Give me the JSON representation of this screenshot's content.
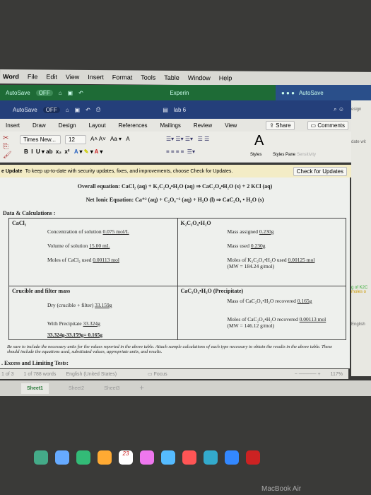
{
  "menubar": {
    "items": [
      "Word",
      "File",
      "Edit",
      "View",
      "Insert",
      "Format",
      "Tools",
      "Table",
      "Window",
      "Help"
    ]
  },
  "excel": {
    "autosave": "AutoSave",
    "toggle": "OFF",
    "doc": "Experin",
    "autosave2": "AutoSave"
  },
  "word": {
    "autosave": "AutoSave",
    "toggle": "OFF",
    "title": "lab 6"
  },
  "tabs": [
    "Insert",
    "Draw",
    "Design",
    "Layout",
    "References",
    "Mailings",
    "Review",
    "View"
  ],
  "share": "Share",
  "comments": "Comments",
  "ribbon": {
    "font": "Times New...",
    "size": "12",
    "styles": "Styles",
    "styles_pane": "Styles Pane",
    "sensitivity": "Sensitivity"
  },
  "update": {
    "label": "e Update",
    "message": "To keep up-to-date with security updates, fixes, and improvements, choose Check for Updates.",
    "button": "Check for Updates"
  },
  "doc": {
    "overall": "Overall equation: CaCl₂ (aq) + K₂C₂O₄•H₂O (aq) ⇒ CaC₂O₄•H₂O (s) + 2 KCl (aq)",
    "net": "Net Ionic Equation: Ca⁺² (aq) + C₂O₄⁻² (aq) + H₂O (l) ⇒ CaC₂O₄ • H₂O (s)",
    "section": "Data & Calculations :",
    "cacl2": {
      "head": "CaCl₂",
      "conc": "Concentration of solution",
      "conc_v": "0.075 mol/L",
      "vol": "Volume of solution",
      "vol_v": "15.00 mL",
      "moles": "Moles of CaCl₂ used",
      "moles_v": "0.00113 mol"
    },
    "k": {
      "head": "K₂C₂O₄•H₂O",
      "assigned": "Mass assigned",
      "assigned_v": "0.230g",
      "used": "Mass used",
      "used_v": "0.230g",
      "moles": "Moles of K₂C₂O₄•H₂O used",
      "moles_v": "0.00125 mol",
      "mw": "(MW = 184.24 g/mol)"
    },
    "crucible": {
      "head": "Crucible and filter mass",
      "dry": "Dry (crucible + filter)",
      "dry_v": "33.159g",
      "with": "With Precipitate",
      "with_v": "33.324g",
      "calc": "33.324g-33.159g= 0.165g"
    },
    "precip": {
      "head": "CaC₂O₄•H₂O (Precipitate)",
      "mass": "Mass of CaC₂O₄•H₂O recovered",
      "mass_v": "0.165g",
      "moles": "Moles of CaC₂O₄•H₂O recovered",
      "moles_v": "0.00113 mol",
      "mw": "(MW = 146.12 g/mol)"
    },
    "note": "Be sure to include the necessary units for the values reported in the above table.  Attach sample calculations of each type necessary to obtain the results in the above table.  These should include the equations used, substituted values, appropriate units, and results.",
    "next": ". Excess and Limiting Tests:"
  },
  "status": {
    "page": "1 of 3",
    "words": "1 of 788 words",
    "lang": "English (United States)",
    "focus": "Focus",
    "zoom": "117%"
  },
  "sheets": [
    "Sheet1",
    "Sheet2",
    "Sheet3",
    "+"
  ],
  "side": {
    "design": "esign",
    "date": "date wit",
    "legend1": "g of K2C",
    "legend2": "moles o",
    "lang": "English"
  },
  "dock_badge": "23",
  "brand": "MacBook Air"
}
